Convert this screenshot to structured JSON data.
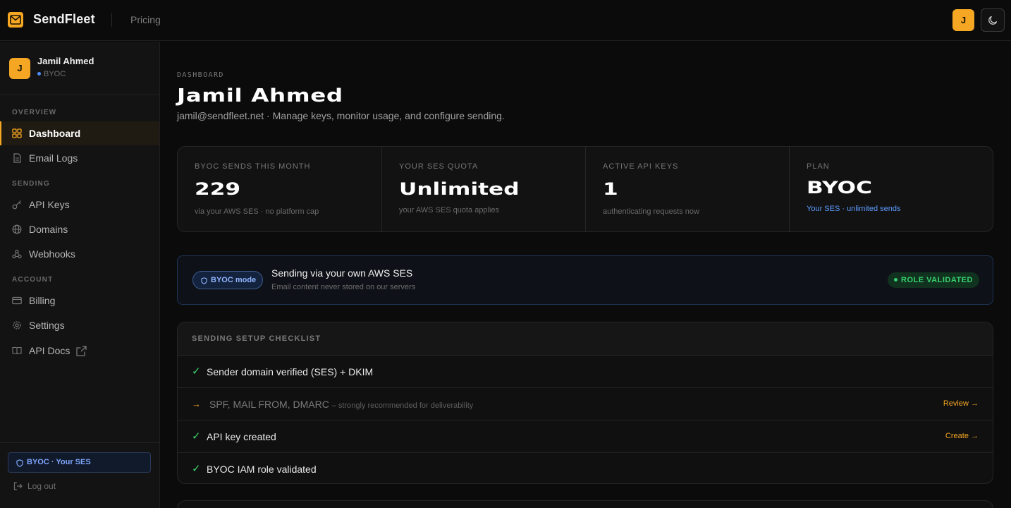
{
  "app": {
    "brand": "SendFleet",
    "nav_pricing": "Pricing",
    "avatar_initial": "J",
    "accent": "#f5a623"
  },
  "user": {
    "initial": "J",
    "name": "Jamil Ahmed",
    "plan": "BYOC"
  },
  "sidebar": {
    "sections": {
      "overview": "OVERVIEW",
      "sending": "SENDING",
      "account": "ACCOUNT"
    },
    "items": [
      {
        "label": "Dashboard",
        "icon": "grid-icon",
        "active": true
      },
      {
        "label": "Email Logs",
        "icon": "file-icon"
      },
      {
        "label": "API Keys",
        "icon": "key-icon"
      },
      {
        "label": "Domains",
        "icon": "globe-icon"
      },
      {
        "label": "Webhooks",
        "icon": "webhook-icon"
      },
      {
        "label": "Billing",
        "icon": "card-icon"
      },
      {
        "label": "Settings",
        "icon": "gear-icon"
      },
      {
        "label": "API Docs",
        "icon": "book-icon"
      }
    ],
    "byoc_pill": "BYOC · Your SES",
    "logout": "Log out"
  },
  "header": {
    "kicker": "DASHBOARD",
    "title": "Jamil Ahmed",
    "subtitle": "jamil@sendfleet.net · Manage keys, monitor usage, and configure sending."
  },
  "stats": [
    {
      "label": "BYOC SENDS THIS MONTH",
      "value": "229",
      "note": "via your AWS SES · no platform cap"
    },
    {
      "label": "YOUR SES QUOTA",
      "value": "Unlimited",
      "note": "your AWS SES quota applies"
    },
    {
      "label": "ACTIVE API KEYS",
      "value": "1",
      "note": "authenticating requests now"
    },
    {
      "label": "PLAN",
      "value": "BYOC",
      "note": "Your SES · unlimited sends"
    }
  ],
  "byoc": {
    "badge": "BYOC mode",
    "title": "Sending via your own AWS SES",
    "subtitle": "Email content never stored on our servers",
    "status": "ROLE VALIDATED"
  },
  "checklist": {
    "title": "SENDING SETUP CHECKLIST",
    "items": [
      {
        "mark": "✓",
        "text": "Sender domain verified (SES) + DKIM",
        "hint": "",
        "action": ""
      },
      {
        "mark": "→",
        "text": "SPF, MAIL FROM, DMARC",
        "hint": "– strongly recommended for deliverability",
        "action": "Review →"
      },
      {
        "mark": "✓",
        "text": "API key created",
        "hint": "",
        "action": "Create →"
      },
      {
        "mark": "✓",
        "text": "BYOC IAM role validated",
        "hint": "",
        "action": ""
      }
    ]
  }
}
